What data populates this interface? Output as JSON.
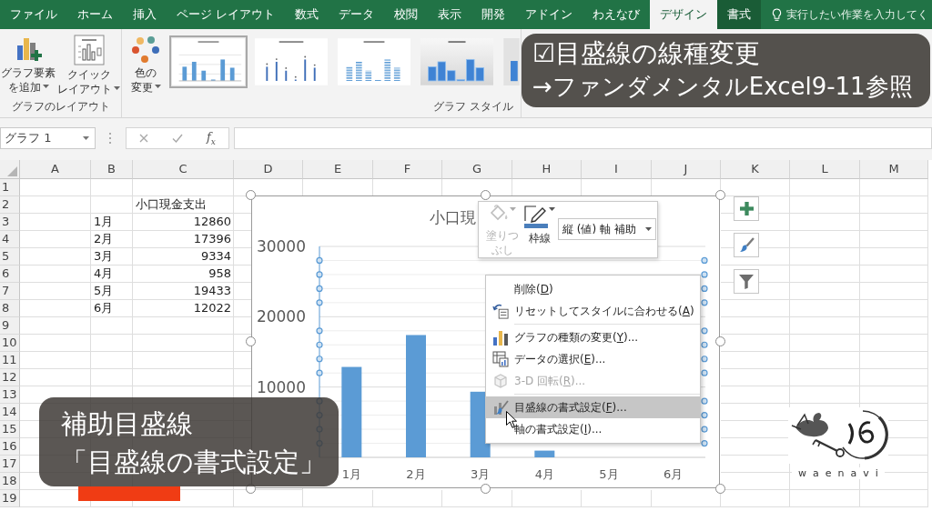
{
  "ribbon_tabs": [
    {
      "label": "ファイル",
      "selected": false,
      "contextual": false
    },
    {
      "label": "ホーム",
      "selected": false,
      "contextual": false
    },
    {
      "label": "挿入",
      "selected": false,
      "contextual": false
    },
    {
      "label": "ページ レイアウト",
      "selected": false,
      "contextual": false
    },
    {
      "label": "数式",
      "selected": false,
      "contextual": false
    },
    {
      "label": "データ",
      "selected": false,
      "contextual": false
    },
    {
      "label": "校閲",
      "selected": false,
      "contextual": false
    },
    {
      "label": "表示",
      "selected": false,
      "contextual": false
    },
    {
      "label": "開発",
      "selected": false,
      "contextual": false
    },
    {
      "label": "アドイン",
      "selected": false,
      "contextual": false
    },
    {
      "label": "わえなび",
      "selected": false,
      "contextual": false
    },
    {
      "label": "デザイン",
      "selected": true,
      "contextual": true
    },
    {
      "label": "書式",
      "selected": false,
      "contextual": true
    }
  ],
  "tell_me": {
    "placeholder": "実行したい作業を入力してく"
  },
  "ribbon": {
    "layout_group": {
      "label": "グラフのレイアウト",
      "buttons": [
        {
          "lines": [
            "グラフ要素",
            "を追加"
          ],
          "dropdown": true
        },
        {
          "lines": [
            "クイック",
            "レイアウト"
          ],
          "dropdown": true
        }
      ]
    },
    "style_group": {
      "label": "グラフ スタイル",
      "buttons": [
        {
          "lines": [
            "色の",
            "変更"
          ],
          "dropdown": true
        }
      ],
      "gallery": [
        {
          "kind": "plain",
          "selected": true
        },
        {
          "kind": "thin",
          "selected": false
        },
        {
          "kind": "striped",
          "selected": false
        },
        {
          "kind": "shaded",
          "selected": false
        },
        {
          "kind": "cut",
          "selected": false
        }
      ]
    }
  },
  "tip_overlay": {
    "lines": [
      "☑目盛線の線種変更",
      "→ファンダメンタルExcel9-11参照"
    ]
  },
  "formula_bar": {
    "name_box": "グラフ 1",
    "function_button": "f$_{x}$"
  },
  "sheet": {
    "columns": [
      "A",
      "B",
      "C",
      "D",
      "E",
      "F",
      "G",
      "H",
      "I",
      "J",
      "K",
      "L",
      "M"
    ],
    "rows": [
      {
        "number": "1"
      },
      {
        "number": "2",
        "c": {
          "text": "小口現金支出",
          "kind": "text"
        }
      },
      {
        "number": "3",
        "b": {
          "text": "1月",
          "kind": "text"
        },
        "c": {
          "text": "12860",
          "kind": "number"
        }
      },
      {
        "number": "4",
        "b": {
          "text": "2月",
          "kind": "text"
        },
        "c": {
          "text": "17396",
          "kind": "number"
        }
      },
      {
        "number": "5",
        "b": {
          "text": "3月",
          "kind": "text"
        },
        "c": {
          "text": "9334",
          "kind": "number"
        }
      },
      {
        "number": "6",
        "b": {
          "text": "4月",
          "kind": "text"
        },
        "c": {
          "text": "958",
          "kind": "number"
        }
      },
      {
        "number": "7",
        "b": {
          "text": "5月",
          "kind": "text"
        },
        "c": {
          "text": "19433",
          "kind": "number"
        }
      },
      {
        "number": "8",
        "b": {
          "text": "6月",
          "kind": "text"
        },
        "c": {
          "text": "12022",
          "kind": "number"
        }
      },
      {
        "number": "9"
      },
      {
        "number": "10"
      },
      {
        "number": "11"
      },
      {
        "number": "12"
      },
      {
        "number": "13"
      },
      {
        "number": "14"
      },
      {
        "number": "15"
      },
      {
        "number": "16"
      },
      {
        "number": "17"
      },
      {
        "number": "18"
      },
      {
        "number": "19"
      }
    ]
  },
  "chart": {
    "selected": true,
    "minor_gridlines_selected": true,
    "chart_data": {
      "type": "bar",
      "title": "小口現",
      "categories": [
        "1月",
        "2月",
        "3月",
        "4月",
        "5月",
        "6月"
      ],
      "series": [
        {
          "color": "#5b9bd5",
          "values": [
            12860,
            17396,
            9334,
            958,
            null,
            null
          ]
        }
      ],
      "ylim": [
        0,
        30000
      ],
      "yticks": [
        10000,
        20000,
        30000
      ]
    }
  },
  "mini_toolbar": {
    "fill": {
      "label": "塗りつぶし",
      "disabled": true
    },
    "outline": {
      "label": "枠線",
      "disabled": false
    },
    "element_select": {
      "value": "縦 (値) 軸 補助"
    }
  },
  "context_menu": {
    "groups": [
      {
        "items": [
          {
            "label": "削除(",
            "key": "D",
            "after": ")",
            "disabled": false,
            "highlighted": false
          },
          {
            "label": "リセットしてスタイルに合わせる(",
            "key": "A",
            "after": ")",
            "disabled": false,
            "highlighted": false
          }
        ]
      },
      {
        "items": [
          {
            "label": "グラフの種類の変更(",
            "key": "Y",
            "after": ")...",
            "disabled": false,
            "highlighted": false
          },
          {
            "label": "データの選択(",
            "key": "E",
            "after": ")...",
            "disabled": false,
            "highlighted": false
          },
          {
            "label": "3-D 回転(",
            "key": "R",
            "after": ")...",
            "disabled": true,
            "highlighted": false
          }
        ]
      },
      {
        "items": [
          {
            "label": "目盛線の書式設定(",
            "key": "F",
            "after": ")...",
            "disabled": false,
            "highlighted": true
          },
          {
            "label": "軸の書式設定(",
            "key": "I",
            "after": ")...",
            "disabled": false,
            "highlighted": false
          }
        ]
      }
    ]
  },
  "caption": {
    "lines": [
      "補助目盛線",
      "「目盛線の書式設定」"
    ]
  },
  "logo": {
    "text": "waenavi"
  }
}
